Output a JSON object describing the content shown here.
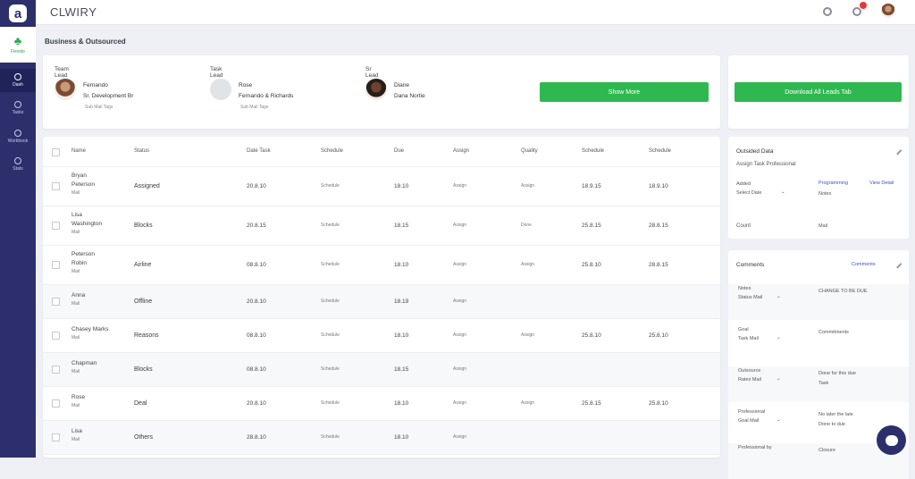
{
  "app": {
    "logo_letter": "a",
    "title": "CLWIRY"
  },
  "sidebar": {
    "brand_label": "Flexide",
    "items": [
      {
        "label": "Dash",
        "icon": "home-icon",
        "active": true
      },
      {
        "label": "Tasks",
        "icon": "list-icon",
        "active": false
      },
      {
        "label": "Workbook",
        "icon": "book-icon",
        "active": false
      },
      {
        "label": "Stats",
        "icon": "chart-icon",
        "active": false
      }
    ]
  },
  "page": {
    "title": "Business & Outsourced"
  },
  "team": {
    "members": [
      {
        "role": "Team Lead",
        "name": "Fernando",
        "sub": "Sr. Development Br",
        "meta": "Sub Mail Tags"
      },
      {
        "role": "Task Lead",
        "name": "Rose",
        "sub": "Fernando & Richards",
        "meta": "Sub Mail Tags"
      },
      {
        "role": "Sr Lead",
        "name": "Diane",
        "sub": "Dana Nortie",
        "meta": ""
      }
    ],
    "action_button": "Show More",
    "invite_button": "Download All Leads Tab"
  },
  "table": {
    "headers": [
      "Name",
      "Status",
      "Date Task",
      "Schedule",
      "Due",
      "Assign",
      "Quality",
      "Schedule",
      "Schedule"
    ],
    "rows": [
      {
        "name": [
          "Bryan",
          "Peterson"
        ],
        "meta": "Mail",
        "status": "Assigned",
        "date": "20.8.10",
        "schedule": "Schedule",
        "due": "18.10",
        "assign": "Assign",
        "quality": "Assign",
        "s1": "18.9.15",
        "s2": "18.9.10"
      },
      {
        "name": [
          "Lisa",
          "Washington"
        ],
        "meta": "Mail",
        "status": "Blocks",
        "date": "20.8.15",
        "schedule": "Schedule",
        "due": "18.15",
        "assign": "Assign",
        "quality": "Done",
        "s1": "25.8.15",
        "s2": "28.8.15"
      },
      {
        "name": [
          "Peterson",
          "Robin"
        ],
        "meta": "Mail",
        "status": "Airline",
        "date": "08.8.10",
        "schedule": "Schedule",
        "due": "18.10",
        "assign": "Assign",
        "quality": "Assign",
        "s1": "25.8.10",
        "s2": "28.8.15"
      },
      {
        "name": [
          "Anna",
          "Mail"
        ],
        "meta": "",
        "status": "Offline",
        "date": "20.8.10",
        "schedule": "Schedule",
        "due": "18.19",
        "assign": "Assign",
        "quality": "",
        "s1": "",
        "s2": ""
      },
      {
        "name": [
          "Chasey Marks",
          "Mail"
        ],
        "meta": "",
        "status": "Reasons",
        "date": "08.8.10",
        "schedule": "Schedule",
        "due": "18.10",
        "assign": "Assign",
        "quality": "Assign",
        "s1": "25.8.10",
        "s2": "25.8.10"
      },
      {
        "name": [
          "Chapman",
          "Mail"
        ],
        "meta": "",
        "status": "Blocks",
        "date": "08.8.10",
        "schedule": "Schedule",
        "due": "18.15",
        "assign": "Assign",
        "quality": "",
        "s1": "",
        "s2": ""
      },
      {
        "name": [
          "Rose",
          "Mail"
        ],
        "meta": "",
        "status": "Deal",
        "date": "20.8.10",
        "schedule": "Schedule",
        "due": "18.10",
        "assign": "Assign",
        "quality": "Assign",
        "s1": "25.8.15",
        "s2": "25.8.10"
      },
      {
        "name": [
          "Lisa",
          "Mail"
        ],
        "meta": "",
        "status": "Others",
        "date": "28.8.10",
        "schedule": "Schedule",
        "due": "18.10",
        "assign": "Assign",
        "quality": "",
        "s1": "",
        "s2": ""
      }
    ]
  },
  "team_panel": {
    "title": "Outsided Data",
    "subtitle": "Assign Task Professional",
    "field_label": "Added",
    "field_value": "Select Date",
    "link_value": "Programming",
    "link_sub": "Notes",
    "link_right": "View Detail",
    "foot_label": "Count",
    "foot_value": "Mail"
  },
  "comment_panel": {
    "title": "Comments",
    "link": "Comments",
    "entries": [
      {
        "label": "Notes",
        "sub": "Status Mail",
        "value": "CHANGE TO BE DUE"
      },
      {
        "label": "Goal",
        "sub": "Task Mail",
        "value": "Commitments"
      },
      {
        "label": "Outsource",
        "sub": "Rates Mail",
        "value": "Done for this due",
        "value2": "Task"
      },
      {
        "label": "Professional",
        "sub": "Goal Mail",
        "value": "No later the late",
        "value2": "Done to due"
      },
      {
        "label": "Professional by",
        "sub": "",
        "value": "Closure",
        "value2": ""
      }
    ]
  },
  "colors": {
    "sidebar": "#2c2f6b",
    "accent": "#2fb84f",
    "link": "#3b53c6",
    "alert": "#e53935"
  }
}
